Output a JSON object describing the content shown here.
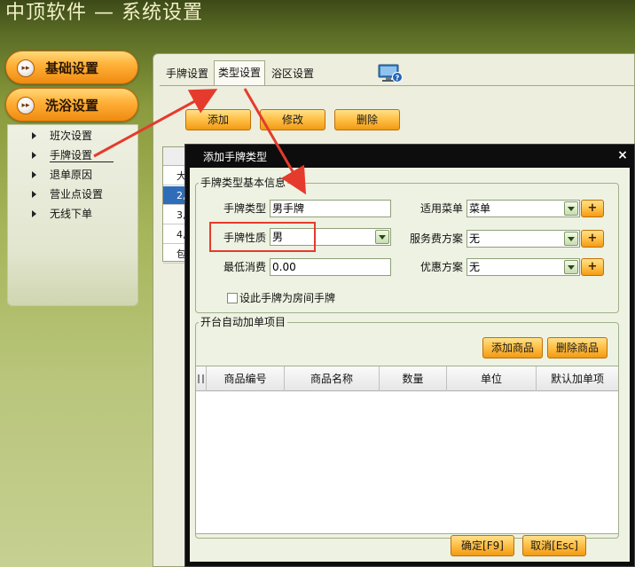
{
  "app": {
    "title": "中顶软件 — 系统设置"
  },
  "sidebar": {
    "sections": [
      {
        "label": "基础设置"
      },
      {
        "label": "洗浴设置"
      }
    ],
    "items": [
      {
        "label": "班次设置"
      },
      {
        "label": "手牌设置"
      },
      {
        "label": "退单原因"
      },
      {
        "label": "营业点设置"
      },
      {
        "label": "无线下单"
      }
    ]
  },
  "tabs": [
    {
      "label": "手牌设置"
    },
    {
      "label": "类型设置"
    },
    {
      "label": "浴区设置"
    }
  ],
  "toolbar": {
    "add": "添加",
    "edit": "修改",
    "delete": "删除"
  },
  "background_grid": {
    "rows": [
      "大",
      "2,",
      "3,",
      "4,",
      "包"
    ]
  },
  "dialog": {
    "title": "添加手牌类型",
    "close": "×",
    "basic_group": {
      "title": "手牌类型基本信息",
      "card_type_label": "手牌类型",
      "card_type_value": "男手牌",
      "nature_label": "手牌性质",
      "nature_value": "男",
      "min_spend_label": "最低消费",
      "min_spend_value": "0.00",
      "menu_label": "适用菜单",
      "menu_value": "菜单",
      "service_label": "服务费方案",
      "service_value": "无",
      "discount_label": "优惠方案",
      "discount_value": "无",
      "plus": "+",
      "room_card_checkbox": "设此手牌为房间手牌"
    },
    "auto_group": {
      "title": "开台自动加单项目",
      "add_item": "添加商品",
      "delete_item": "删除商品",
      "columns": [
        "商品编号",
        "商品名称",
        "数量",
        "单位",
        "默认加单项"
      ]
    },
    "ok": "确定[F9]",
    "cancel": "取消[Esc]"
  }
}
